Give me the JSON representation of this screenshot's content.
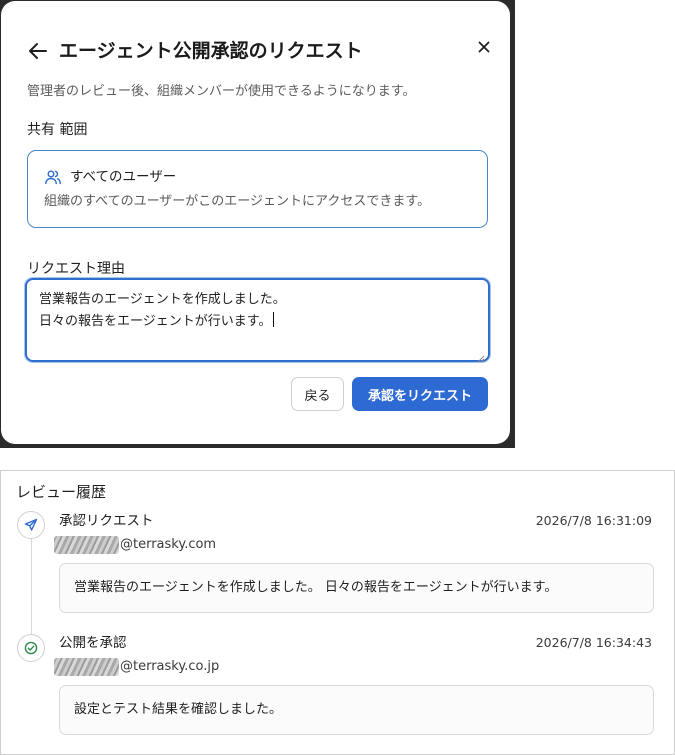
{
  "dialog": {
    "title": "エージェント公開承認のリクエスト",
    "description": "管理者のレビュー後、組織メンバーが使用できるようになります。",
    "close_label": "×",
    "scope_label": "共有 範囲",
    "scope_option": {
      "title": "すべてのユーザー",
      "description": "組織のすべてのユーザーがこのエージェントにアクセスできます。",
      "icon": "users-icon"
    },
    "reason_label": "リクエスト理由",
    "reason_lines": [
      "営業報告のエージェントを作成しました。",
      "日々の報告をエージェントが行います。"
    ],
    "back_button": "戻る",
    "request_button": "承認をリクエスト",
    "accent_color": "#2d6ad3"
  },
  "history": {
    "title": "レビュー履歴",
    "events": [
      {
        "title": "承認リクエスト",
        "timestamp": "2026/7/8 16:31:09",
        "user_domain": "@terrasky.com",
        "comment": "営業報告のエージェントを作成しました。 日々の報告をエージェントが行います。",
        "icon": "send-icon"
      },
      {
        "title": "公開を承認",
        "timestamp": "2026/7/8 16:34:43",
        "user_domain": "@terrasky.co.jp",
        "comment": "設定とテスト結果を確認しました。",
        "icon": "check-circle-icon"
      }
    ]
  }
}
